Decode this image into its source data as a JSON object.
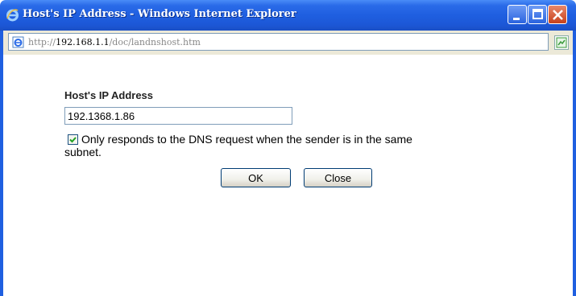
{
  "window": {
    "title": "Host's IP Address - Windows Internet Explorer",
    "icon": "ie-logo-icon",
    "controls": [
      "minimize-icon",
      "maximize-icon",
      "close-icon"
    ]
  },
  "address_bar": {
    "prefix": "http://",
    "host": "192.168.1.1",
    "path": "/doc/landnshost.htm"
  },
  "form": {
    "label": "Host's IP Address",
    "ip_value": "192.1368.1.86",
    "checkbox_checked": true,
    "checkbox_label_line1": "Only responds to the DNS request when the sender is in the same",
    "checkbox_label_line2": "subnet.",
    "ok_label": "OK",
    "close_label": "Close"
  },
  "colors": {
    "titlebar": "#1f5fe0",
    "close_button": "#c7411b",
    "checkbox_tick": "#21a121"
  }
}
